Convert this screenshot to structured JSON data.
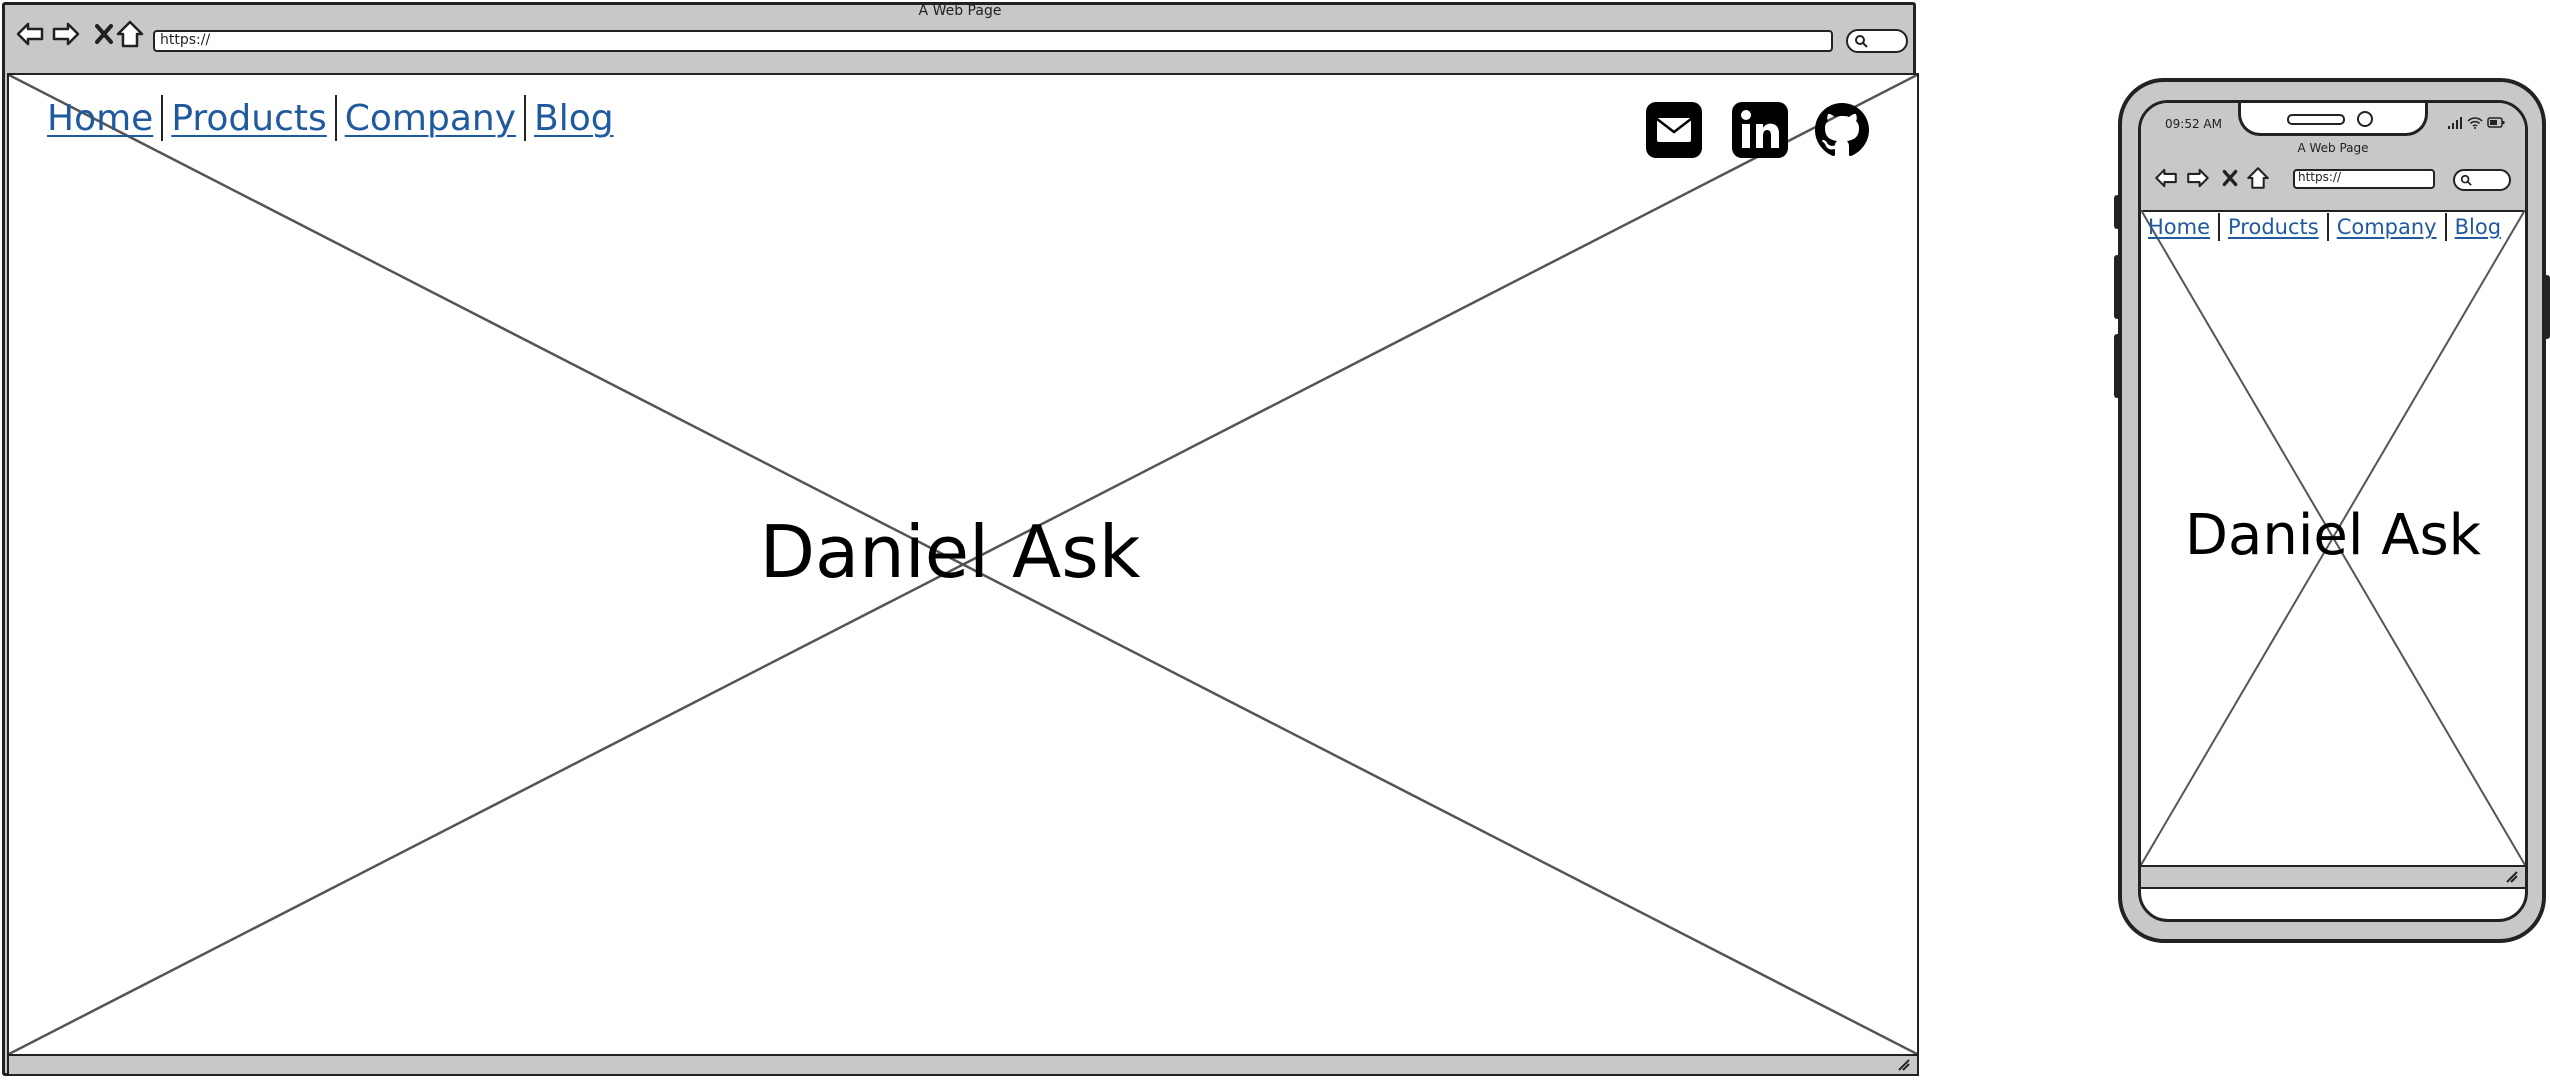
{
  "desktop": {
    "browser_title": "A Web Page",
    "url": "https://",
    "nav_links": [
      "Home",
      "Products",
      "Company",
      "Blog"
    ],
    "hero_title": "Daniel Ask",
    "social_icons": [
      "email-icon",
      "linkedin-icon",
      "github-icon"
    ],
    "toolbar_icons": [
      "back-arrow-icon",
      "forward-arrow-icon",
      "close-icon",
      "home-icon",
      "search-icon"
    ],
    "link_color": "#1f5aa0"
  },
  "mobile": {
    "status_time": "09:52 AM",
    "browser_title": "A Web Page",
    "url": "https://",
    "nav_links": [
      "Home",
      "Products",
      "Company",
      "Blog"
    ],
    "hero_title": "Daniel Ask"
  }
}
